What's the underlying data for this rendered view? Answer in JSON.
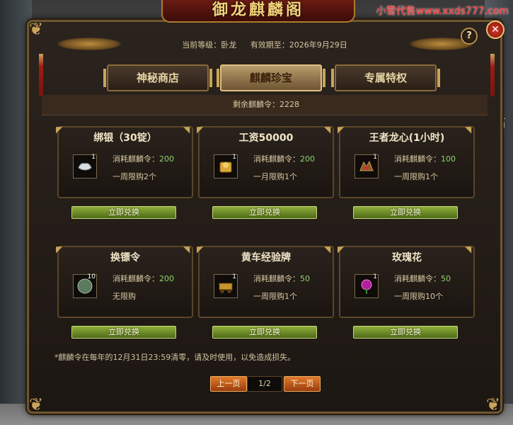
{
  "title": "御龙麒麟阁",
  "watermark": "小雪代售www.xxds777.com",
  "right_glyph": "石",
  "header": {
    "level": "当前等级：卧龙",
    "expiry": "有效期至：2026年9月29日"
  },
  "tabs": [
    {
      "label": "神秘商店",
      "active": false
    },
    {
      "label": "麒麟珍宝",
      "active": true
    },
    {
      "label": "专属特权",
      "active": false
    }
  ],
  "remaining": "剩余麒麟令：2228",
  "cost_label": "消耗麒麟令：",
  "items": [
    {
      "name": "绑银（30锭）",
      "icon": "silver-ingot-icon",
      "count": "1",
      "cost": "200",
      "limit": "一周限购2个",
      "button": "立即兑换"
    },
    {
      "name": "工资50000",
      "icon": "gold-coins-icon",
      "count": "1",
      "cost": "200",
      "limit": "一月限购1个",
      "button": "立即兑换"
    },
    {
      "name": "王者龙心(1小时)",
      "icon": "dragon-heart-icon",
      "count": "1",
      "cost": "100",
      "limit": "一周限购1个",
      "button": "立即兑换"
    },
    {
      "name": "换镖令",
      "icon": "escort-token-icon",
      "count": "10",
      "cost": "200",
      "limit": "无限购",
      "button": "立即兑换"
    },
    {
      "name": "黄车经验牌",
      "icon": "cart-exp-icon",
      "count": "1",
      "cost": "50",
      "limit": "一周限购1个",
      "button": "立即兑换"
    },
    {
      "name": "玫瑰花",
      "icon": "rose-icon",
      "count": "1",
      "cost": "50",
      "limit": "一周限购10个",
      "button": "立即兑换"
    }
  ],
  "note": "*麒麟令在每年的12月31日23:59清零，请及时使用，以免造成损失。",
  "pager": {
    "prev": "上一页",
    "page": "1/2",
    "next": "下一页"
  },
  "colors": {
    "accent_gold": "#c9a45a",
    "cost_green": "#8fd46a",
    "button_green": "#6f8f26",
    "pager_orange": "#c65a1a"
  }
}
